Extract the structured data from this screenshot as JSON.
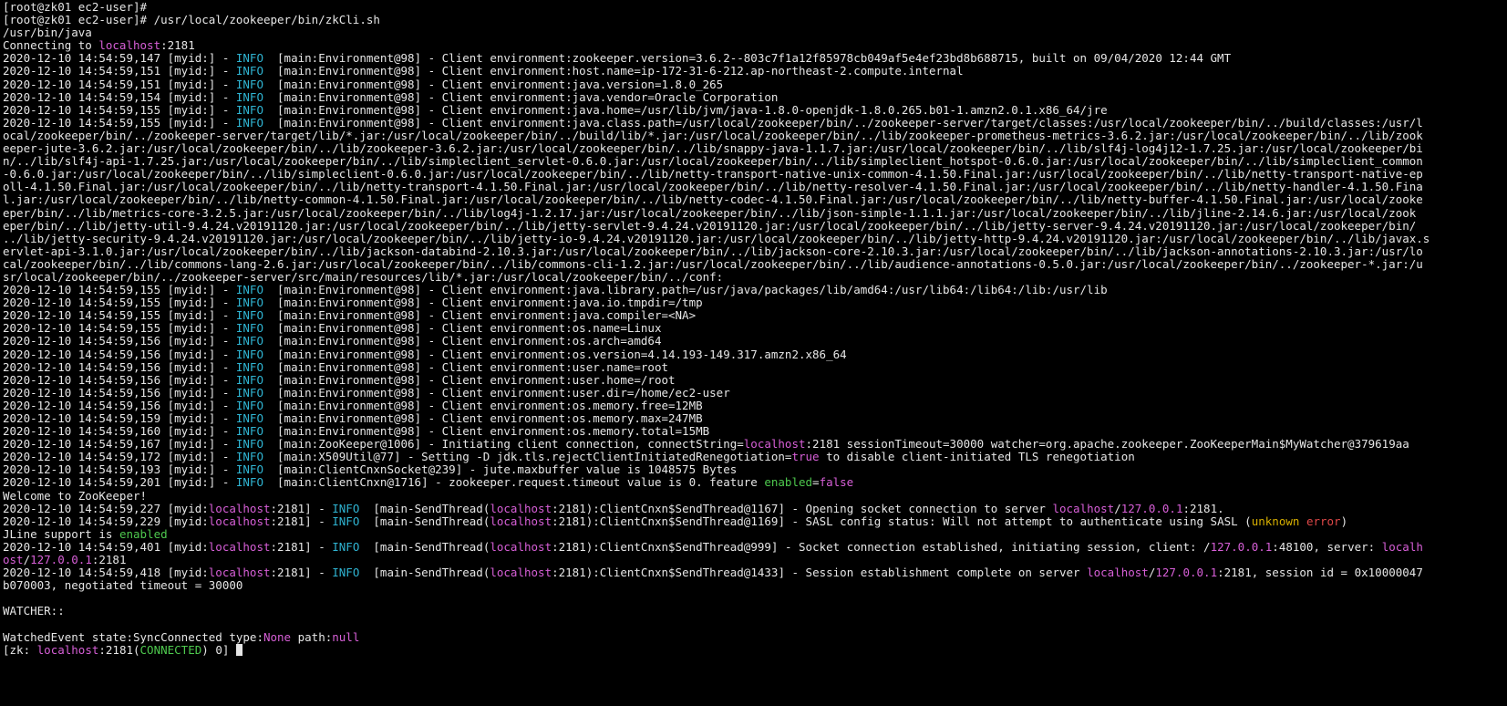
{
  "colors": {
    "background": "#000000",
    "text": "#e6e6e6",
    "cyan": "#2fb4d2",
    "magenta": "#d75fd7",
    "green": "#4ec94e",
    "yellow": "#d7af00",
    "red": "#e04848"
  },
  "terminal": {
    "lines": [
      [
        {
          "t": "[root@zk01 ec2-user]#"
        }
      ],
      [
        {
          "t": "[root@zk01 ec2-user]# /usr/local/zookeeper/bin/zkCli.sh"
        }
      ],
      [
        {
          "t": "/usr/bin/java"
        }
      ],
      [
        {
          "t": "Connecting to "
        },
        {
          "t": "localhost",
          "c": "magenta"
        },
        {
          "t": ":2181"
        }
      ],
      [
        {
          "t": "2020-12-10 14:54:59,147 [myid:] - "
        },
        {
          "t": "INFO",
          "c": "cyan"
        },
        {
          "t": "  [main:Environment@98] - Client environment:zookeeper.version=3.6.2--803c7f1a12f85978cb049af5e4ef23bd8b688715, built on 09/04/2020 12:44 GMT"
        }
      ],
      [
        {
          "t": "2020-12-10 14:54:59,151 [myid:] - "
        },
        {
          "t": "INFO",
          "c": "cyan"
        },
        {
          "t": "  [main:Environment@98] - Client environment:host.name=ip-172-31-6-212.ap-northeast-2.compute.internal"
        }
      ],
      [
        {
          "t": "2020-12-10 14:54:59,151 [myid:] - "
        },
        {
          "t": "INFO",
          "c": "cyan"
        },
        {
          "t": "  [main:Environment@98] - Client environment:java.version=1.8.0_265"
        }
      ],
      [
        {
          "t": "2020-12-10 14:54:59,154 [myid:] - "
        },
        {
          "t": "INFO",
          "c": "cyan"
        },
        {
          "t": "  [main:Environment@98] - Client environment:java.vendor=Oracle Corporation"
        }
      ],
      [
        {
          "t": "2020-12-10 14:54:59,155 [myid:] - "
        },
        {
          "t": "INFO",
          "c": "cyan"
        },
        {
          "t": "  [main:Environment@98] - Client environment:java.home=/usr/lib/jvm/java-1.8.0-openjdk-1.8.0.265.b01-1.amzn2.0.1.x86_64/jre"
        }
      ],
      [
        {
          "t": "2020-12-10 14:54:59,155 [myid:] - "
        },
        {
          "t": "INFO",
          "c": "cyan"
        },
        {
          "t": "  [main:Environment@98] - Client environment:java.class.path=/usr/local/zookeeper/bin/../zookeeper-server/target/classes:/usr/local/zookeeper/bin/../build/classes:/usr/l"
        }
      ],
      [
        {
          "t": "ocal/zookeeper/bin/../zookeeper-server/target/lib/*.jar:/usr/local/zookeeper/bin/../build/lib/*.jar:/usr/local/zookeeper/bin/../lib/zookeeper-prometheus-metrics-3.6.2.jar:/usr/local/zookeeper/bin/../lib/zook"
        }
      ],
      [
        {
          "t": "eeper-jute-3.6.2.jar:/usr/local/zookeeper/bin/../lib/zookeeper-3.6.2.jar:/usr/local/zookeeper/bin/../lib/snappy-java-1.1.7.jar:/usr/local/zookeeper/bin/../lib/slf4j-log4j12-1.7.25.jar:/usr/local/zookeeper/bi"
        }
      ],
      [
        {
          "t": "n/../lib/slf4j-api-1.7.25.jar:/usr/local/zookeeper/bin/../lib/simpleclient_servlet-0.6.0.jar:/usr/local/zookeeper/bin/../lib/simpleclient_hotspot-0.6.0.jar:/usr/local/zookeeper/bin/../lib/simpleclient_common"
        }
      ],
      [
        {
          "t": "-0.6.0.jar:/usr/local/zookeeper/bin/../lib/simpleclient-0.6.0.jar:/usr/local/zookeeper/bin/../lib/netty-transport-native-unix-common-4.1.50.Final.jar:/usr/local/zookeeper/bin/../lib/netty-transport-native-ep"
        }
      ],
      [
        {
          "t": "oll-4.1.50.Final.jar:/usr/local/zookeeper/bin/../lib/netty-transport-4.1.50.Final.jar:/usr/local/zookeeper/bin/../lib/netty-resolver-4.1.50.Final.jar:/usr/local/zookeeper/bin/../lib/netty-handler-4.1.50.Fina"
        }
      ],
      [
        {
          "t": "l.jar:/usr/local/zookeeper/bin/../lib/netty-common-4.1.50.Final.jar:/usr/local/zookeeper/bin/../lib/netty-codec-4.1.50.Final.jar:/usr/local/zookeeper/bin/../lib/netty-buffer-4.1.50.Final.jar:/usr/local/zooke"
        }
      ],
      [
        {
          "t": "eper/bin/../lib/metrics-core-3.2.5.jar:/usr/local/zookeeper/bin/../lib/log4j-1.2.17.jar:/usr/local/zookeeper/bin/../lib/json-simple-1.1.1.jar:/usr/local/zookeeper/bin/../lib/jline-2.14.6.jar:/usr/local/zook"
        }
      ],
      [
        {
          "t": "eper/bin/../lib/jetty-util-9.4.24.v20191120.jar:/usr/local/zookeeper/bin/../lib/jetty-servlet-9.4.24.v20191120.jar:/usr/local/zookeeper/bin/../lib/jetty-server-9.4.24.v20191120.jar:/usr/local/zookeeper/bin/"
        }
      ],
      [
        {
          "t": "../lib/jetty-security-9.4.24.v20191120.jar:/usr/local/zookeeper/bin/../lib/jetty-io-9.4.24.v20191120.jar:/usr/local/zookeeper/bin/../lib/jetty-http-9.4.24.v20191120.jar:/usr/local/zookeeper/bin/../lib/javax.s"
        }
      ],
      [
        {
          "t": "ervlet-api-3.1.0.jar:/usr/local/zookeeper/bin/../lib/jackson-databind-2.10.3.jar:/usr/local/zookeeper/bin/../lib/jackson-core-2.10.3.jar:/usr/local/zookeeper/bin/../lib/jackson-annotations-2.10.3.jar:/usr/lo"
        }
      ],
      [
        {
          "t": "cal/zookeeper/bin/../lib/commons-lang-2.6.jar:/usr/local/zookeeper/bin/../lib/commons-cli-1.2.jar:/usr/local/zookeeper/bin/../lib/audience-annotations-0.5.0.jar:/usr/local/zookeeper/bin/../zookeeper-*.jar:/u"
        }
      ],
      [
        {
          "t": "sr/local/zookeeper/bin/../zookeeper-server/src/main/resources/lib/*.jar:/usr/local/zookeeper/bin/../conf:"
        }
      ],
      [
        {
          "t": "2020-12-10 14:54:59,155 [myid:] - "
        },
        {
          "t": "INFO",
          "c": "cyan"
        },
        {
          "t": "  [main:Environment@98] - Client environment:java.library.path=/usr/java/packages/lib/amd64:/usr/lib64:/lib64:/lib:/usr/lib"
        }
      ],
      [
        {
          "t": "2020-12-10 14:54:59,155 [myid:] - "
        },
        {
          "t": "INFO",
          "c": "cyan"
        },
        {
          "t": "  [main:Environment@98] - Client environment:java.io.tmpdir=/tmp"
        }
      ],
      [
        {
          "t": "2020-12-10 14:54:59,155 [myid:] - "
        },
        {
          "t": "INFO",
          "c": "cyan"
        },
        {
          "t": "  [main:Environment@98] - Client environment:java.compiler=<NA>"
        }
      ],
      [
        {
          "t": "2020-12-10 14:54:59,155 [myid:] - "
        },
        {
          "t": "INFO",
          "c": "cyan"
        },
        {
          "t": "  [main:Environment@98] - Client environment:os.name=Linux"
        }
      ],
      [
        {
          "t": "2020-12-10 14:54:59,156 [myid:] - "
        },
        {
          "t": "INFO",
          "c": "cyan"
        },
        {
          "t": "  [main:Environment@98] - Client environment:os.arch=amd64"
        }
      ],
      [
        {
          "t": "2020-12-10 14:54:59,156 [myid:] - "
        },
        {
          "t": "INFO",
          "c": "cyan"
        },
        {
          "t": "  [main:Environment@98] - Client environment:os.version=4.14.193-149.317.amzn2.x86_64"
        }
      ],
      [
        {
          "t": "2020-12-10 14:54:59,156 [myid:] - "
        },
        {
          "t": "INFO",
          "c": "cyan"
        },
        {
          "t": "  [main:Environment@98] - Client environment:user.name=root"
        }
      ],
      [
        {
          "t": "2020-12-10 14:54:59,156 [myid:] - "
        },
        {
          "t": "INFO",
          "c": "cyan"
        },
        {
          "t": "  [main:Environment@98] - Client environment:user.home=/root"
        }
      ],
      [
        {
          "t": "2020-12-10 14:54:59,156 [myid:] - "
        },
        {
          "t": "INFO",
          "c": "cyan"
        },
        {
          "t": "  [main:Environment@98] - Client environment:user.dir=/home/ec2-user"
        }
      ],
      [
        {
          "t": "2020-12-10 14:54:59,156 [myid:] - "
        },
        {
          "t": "INFO",
          "c": "cyan"
        },
        {
          "t": "  [main:Environment@98] - Client environment:os.memory.free=12MB"
        }
      ],
      [
        {
          "t": "2020-12-10 14:54:59,159 [myid:] - "
        },
        {
          "t": "INFO",
          "c": "cyan"
        },
        {
          "t": "  [main:Environment@98] - Client environment:os.memory.max=247MB"
        }
      ],
      [
        {
          "t": "2020-12-10 14:54:59,160 [myid:] - "
        },
        {
          "t": "INFO",
          "c": "cyan"
        },
        {
          "t": "  [main:Environment@98] - Client environment:os.memory.total=15MB"
        }
      ],
      [
        {
          "t": "2020-12-10 14:54:59,167 [myid:] - "
        },
        {
          "t": "INFO",
          "c": "cyan"
        },
        {
          "t": "  [main:ZooKeeper@1006] - Initiating client connection, connectString="
        },
        {
          "t": "localhost",
          "c": "magenta"
        },
        {
          "t": ":2181 sessionTimeout=30000 watcher=org.apache.zookeeper.ZooKeeperMain$MyWatcher@379619aa"
        }
      ],
      [
        {
          "t": "2020-12-10 14:54:59,172 [myid:] - "
        },
        {
          "t": "INFO",
          "c": "cyan"
        },
        {
          "t": "  [main:X509Util@77] - Setting -D jdk.tls.rejectClientInitiatedRenegotiation="
        },
        {
          "t": "true",
          "c": "magenta"
        },
        {
          "t": " to disable client-initiated TLS renegotiation"
        }
      ],
      [
        {
          "t": "2020-12-10 14:54:59,193 [myid:] - "
        },
        {
          "t": "INFO",
          "c": "cyan"
        },
        {
          "t": "  [main:ClientCnxnSocket@239] - jute.maxbuffer value is 1048575 Bytes"
        }
      ],
      [
        {
          "t": "2020-12-10 14:54:59,201 [myid:] - "
        },
        {
          "t": "INFO",
          "c": "cyan"
        },
        {
          "t": "  [main:ClientCnxn@1716] - zookeeper.request.timeout value is 0. feature "
        },
        {
          "t": "enabled",
          "c": "green"
        },
        {
          "t": "="
        },
        {
          "t": "false",
          "c": "magenta"
        }
      ],
      [
        {
          "t": "Welcome to ZooKeeper!"
        }
      ],
      [
        {
          "t": "2020-12-10 14:54:59,227 [myid:"
        },
        {
          "t": "localhost",
          "c": "magenta"
        },
        {
          "t": ":2181] - "
        },
        {
          "t": "INFO",
          "c": "cyan"
        },
        {
          "t": "  [main-SendThread("
        },
        {
          "t": "localhost",
          "c": "magenta"
        },
        {
          "t": ":2181):ClientCnxn$SendThread@1167] - Opening socket connection to server "
        },
        {
          "t": "localhost",
          "c": "magenta"
        },
        {
          "t": "/"
        },
        {
          "t": "127.0.0.1",
          "c": "magenta"
        },
        {
          "t": ":2181."
        }
      ],
      [
        {
          "t": "2020-12-10 14:54:59,229 [myid:"
        },
        {
          "t": "localhost",
          "c": "magenta"
        },
        {
          "t": ":2181] - "
        },
        {
          "t": "INFO",
          "c": "cyan"
        },
        {
          "t": "  [main-SendThread("
        },
        {
          "t": "localhost",
          "c": "magenta"
        },
        {
          "t": ":2181):ClientCnxn$SendThread@1169] - SASL config status: Will not attempt to authenticate using SASL ("
        },
        {
          "t": "unknown",
          "c": "yellow"
        },
        {
          "t": " "
        },
        {
          "t": "error",
          "c": "red"
        },
        {
          "t": ")"
        }
      ],
      [
        {
          "t": "JLine support is "
        },
        {
          "t": "enabled",
          "c": "green"
        }
      ],
      [
        {
          "t": "2020-12-10 14:54:59,401 [myid:"
        },
        {
          "t": "localhost",
          "c": "magenta"
        },
        {
          "t": ":2181] - "
        },
        {
          "t": "INFO",
          "c": "cyan"
        },
        {
          "t": "  [main-SendThread("
        },
        {
          "t": "localhost",
          "c": "magenta"
        },
        {
          "t": ":2181):ClientCnxn$SendThread@999] - Socket connection established, initiating session, client: /"
        },
        {
          "t": "127.0.0.1",
          "c": "magenta"
        },
        {
          "t": ":48100, server: "
        },
        {
          "t": "localh",
          "c": "magenta"
        }
      ],
      [
        {
          "t": "ost",
          "c": "magenta"
        },
        {
          "t": "/"
        },
        {
          "t": "127.0.0.1",
          "c": "magenta"
        },
        {
          "t": ":2181"
        }
      ],
      [
        {
          "t": "2020-12-10 14:54:59,418 [myid:"
        },
        {
          "t": "localhost",
          "c": "magenta"
        },
        {
          "t": ":2181] - "
        },
        {
          "t": "INFO",
          "c": "cyan"
        },
        {
          "t": "  [main-SendThread("
        },
        {
          "t": "localhost",
          "c": "magenta"
        },
        {
          "t": ":2181):ClientCnxn$SendThread@1433] - Session establishment complete on server "
        },
        {
          "t": "localhost",
          "c": "magenta"
        },
        {
          "t": "/"
        },
        {
          "t": "127.0.0.1",
          "c": "magenta"
        },
        {
          "t": ":2181, session id = 0x10000047"
        }
      ],
      [
        {
          "t": "b070003, negotiated timeout = 30000"
        }
      ],
      [
        {
          "t": ""
        }
      ],
      [
        {
          "t": "WATCHER::"
        }
      ],
      [
        {
          "t": ""
        }
      ],
      [
        {
          "t": "WatchedEvent state:SyncConnected type:"
        },
        {
          "t": "None",
          "c": "magenta"
        },
        {
          "t": " path:"
        },
        {
          "t": "null",
          "c": "magenta"
        }
      ],
      [
        {
          "t": "[zk: "
        },
        {
          "t": "localhost",
          "c": "magenta"
        },
        {
          "t": ":2181("
        },
        {
          "t": "CONNECTED",
          "c": "green"
        },
        {
          "t": ") 0] "
        }
      ]
    ]
  }
}
